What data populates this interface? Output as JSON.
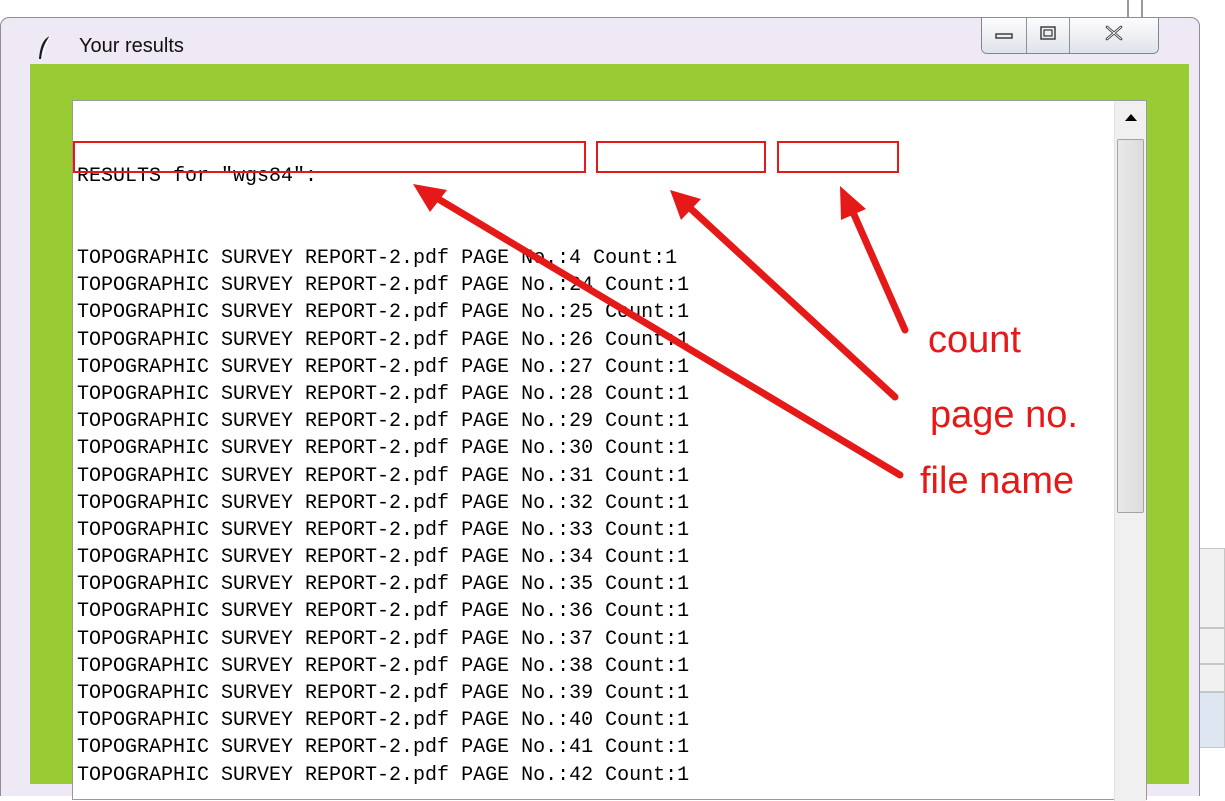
{
  "window": {
    "title": "Your results",
    "icon": "feather-icon",
    "controls": [
      "minimize-icon",
      "maximize-icon",
      "close-icon"
    ]
  },
  "results": {
    "header": "RESULTS for \"wgs84\":",
    "rows": [
      {
        "file": "TOPOGRAPHIC SURVEY REPORT-2.pdf",
        "page": "PAGE No.:4",
        "count": "Count:1"
      },
      {
        "file": "TOPOGRAPHIC SURVEY REPORT-2.pdf",
        "page": "PAGE No.:24",
        "count": "Count:1"
      },
      {
        "file": "TOPOGRAPHIC SURVEY REPORT-2.pdf",
        "page": "PAGE No.:25",
        "count": "Count:1"
      },
      {
        "file": "TOPOGRAPHIC SURVEY REPORT-2.pdf",
        "page": "PAGE No.:26",
        "count": "Count:1"
      },
      {
        "file": "TOPOGRAPHIC SURVEY REPORT-2.pdf",
        "page": "PAGE No.:27",
        "count": "Count:1"
      },
      {
        "file": "TOPOGRAPHIC SURVEY REPORT-2.pdf",
        "page": "PAGE No.:28",
        "count": "Count:1"
      },
      {
        "file": "TOPOGRAPHIC SURVEY REPORT-2.pdf",
        "page": "PAGE No.:29",
        "count": "Count:1"
      },
      {
        "file": "TOPOGRAPHIC SURVEY REPORT-2.pdf",
        "page": "PAGE No.:30",
        "count": "Count:1"
      },
      {
        "file": "TOPOGRAPHIC SURVEY REPORT-2.pdf",
        "page": "PAGE No.:31",
        "count": "Count:1"
      },
      {
        "file": "TOPOGRAPHIC SURVEY REPORT-2.pdf",
        "page": "PAGE No.:32",
        "count": "Count:1"
      },
      {
        "file": "TOPOGRAPHIC SURVEY REPORT-2.pdf",
        "page": "PAGE No.:33",
        "count": "Count:1"
      },
      {
        "file": "TOPOGRAPHIC SURVEY REPORT-2.pdf",
        "page": "PAGE No.:34",
        "count": "Count:1"
      },
      {
        "file": "TOPOGRAPHIC SURVEY REPORT-2.pdf",
        "page": "PAGE No.:35",
        "count": "Count:1"
      },
      {
        "file": "TOPOGRAPHIC SURVEY REPORT-2.pdf",
        "page": "PAGE No.:36",
        "count": "Count:1"
      },
      {
        "file": "TOPOGRAPHIC SURVEY REPORT-2.pdf",
        "page": "PAGE No.:37",
        "count": "Count:1"
      },
      {
        "file": "TOPOGRAPHIC SURVEY REPORT-2.pdf",
        "page": "PAGE No.:38",
        "count": "Count:1"
      },
      {
        "file": "TOPOGRAPHIC SURVEY REPORT-2.pdf",
        "page": "PAGE No.:39",
        "count": "Count:1"
      },
      {
        "file": "TOPOGRAPHIC SURVEY REPORT-2.pdf",
        "page": "PAGE No.:40",
        "count": "Count:1"
      },
      {
        "file": "TOPOGRAPHIC SURVEY REPORT-2.pdf",
        "page": "PAGE No.:41",
        "count": "Count:1"
      },
      {
        "file": "TOPOGRAPHIC SURVEY REPORT-2.pdf",
        "page": "PAGE No.:42",
        "count": "Count:1"
      }
    ]
  },
  "annotations": {
    "count_label": "count",
    "page_label": "page no.",
    "file_label": "file name"
  },
  "scrollbar": {
    "up_icon": "scroll-up-arrow-icon"
  },
  "colors": {
    "accent_green": "#99cc33",
    "annotation_red": "#e61919",
    "titlebar": "#eee9f4"
  }
}
